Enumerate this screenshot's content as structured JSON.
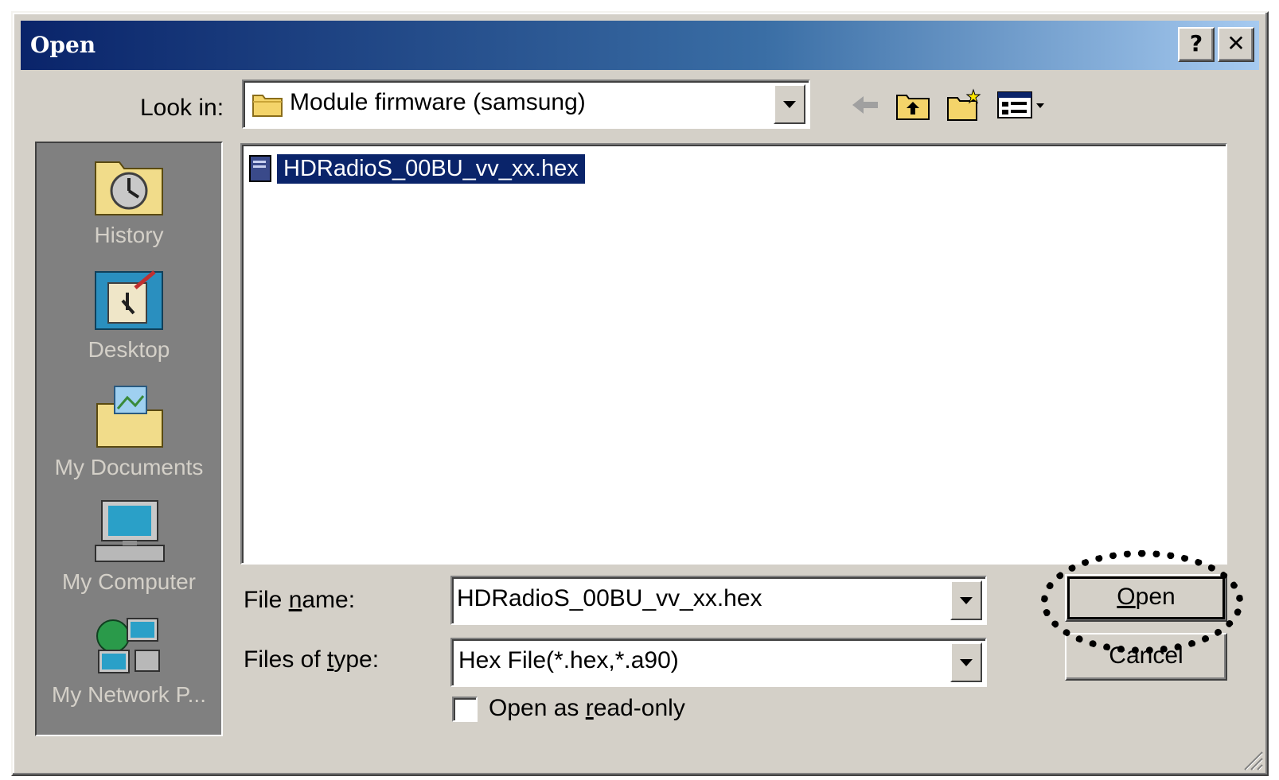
{
  "window": {
    "title": "Open",
    "help_glyph": "?",
    "close_glyph": "✕"
  },
  "lookin": {
    "label": "Look in:",
    "value": "Module firmware (samsung)"
  },
  "toolbar": {
    "icons": [
      "back-arrow-icon",
      "up-one-level-icon",
      "new-folder-icon",
      "view-menu-icon"
    ]
  },
  "places": {
    "items": [
      {
        "label": "History",
        "icon": "history-icon"
      },
      {
        "label": "Desktop",
        "icon": "desktop-icon"
      },
      {
        "label": "My Documents",
        "icon": "my-documents-icon"
      },
      {
        "label": "My Computer",
        "icon": "my-computer-icon"
      },
      {
        "label": "My Network P...",
        "icon": "my-network-places-icon"
      }
    ]
  },
  "files": [
    {
      "name": "HDRadioS_00BU_vv_xx.hex",
      "selected": true
    }
  ],
  "filename": {
    "label": "File name:",
    "value": "HDRadioS_00BU_vv_xx.hex"
  },
  "filetype": {
    "label": "Files of type:",
    "value": "Hex File(*.hex,*.a90)"
  },
  "readonly": {
    "label": "Open as read-only",
    "checked": false
  },
  "buttons": {
    "open": "Open",
    "cancel": "Cancel"
  },
  "colors": {
    "titlebar_start": "#0a246a",
    "titlebar_end": "#a6caf0",
    "selection": "#0a246a",
    "face": "#d4d0c8"
  }
}
